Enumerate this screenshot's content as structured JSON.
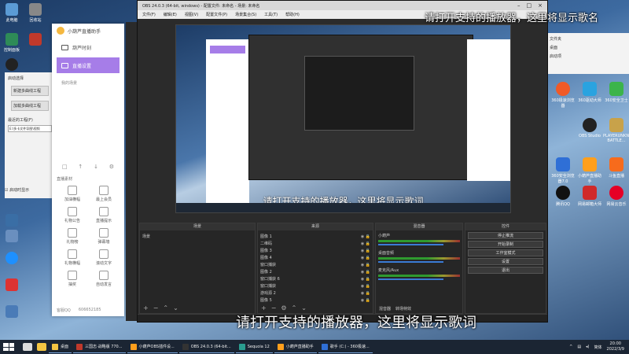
{
  "subtitles": {
    "top": "请打开支持的播放器，这里将显示歌名",
    "preview": "请打开支持的播放器，这里将显示歌词",
    "bottom": "请打开支持的播放器，这里将显示歌词"
  },
  "desktop_left": [
    "此电脑",
    "回收站",
    "控制面板",
    "",
    "",
    "",
    "",
    "",
    "",
    "",
    "",
    "",
    "",
    "",
    "",
    "",
    "",
    "",
    "",
    ""
  ],
  "left_panel": {
    "title": "启动选择",
    "button_new": "新建多曲线工程",
    "button_load": "加载多曲线工程",
    "recent_label": "最近的工程(F)",
    "recent_value": "E:\\多卡文件导图\\视频",
    "checkbox_label": "启动时显示"
  },
  "assistant": {
    "app_name": "小葫芦直播助手",
    "tabs": [
      "葫芦时刻",
      "直播设置"
    ],
    "sub_label": "我的场景",
    "section_label": "直播素材",
    "grid": [
      "加油横幅",
      "最上会员",
      "礼物公告",
      "直播提示",
      "礼物榜",
      "弹幕墙",
      "礼物横幅",
      "滚动文字",
      "抽奖",
      "自动发言"
    ],
    "footer": [
      "客服QQ",
      "606652185"
    ]
  },
  "obs": {
    "title": "OBS 24.0.3 (64-bit, windows) - 配置文件: 未命名 - 场景: 未命名",
    "menu": [
      "文件(F)",
      "编辑(E)",
      "视图(V)",
      "配置文件(P)",
      "场景集合(S)",
      "工具(T)",
      "帮助(H)"
    ],
    "docks": {
      "scenes": {
        "header": "场景",
        "items": [
          "场景"
        ]
      },
      "sources": {
        "header": "来源",
        "items": [
          "图像 1",
          "二维码",
          "图像 3",
          "图像 4",
          "窗口捕获",
          "图像 2",
          "窗口捕获 6",
          "窗口捕获",
          "游戏源 2",
          "图像 5"
        ]
      },
      "mixer": {
        "header": "混音器",
        "channels": [
          "小葫芦",
          "桌面音频",
          "麦克风/Aux"
        ],
        "tabs": [
          "混音器",
          "转场特效"
        ]
      },
      "controls": {
        "header": "控件",
        "buttons": [
          "停止推流",
          "开始录制",
          "工作室模式",
          "设置",
          "退出"
        ]
      }
    }
  },
  "right_window_items": [
    "文件夹",
    "桌面",
    "启动项"
  ],
  "desktop_right": [
    "360极速浏览器",
    "360驱动大师",
    "360安全卫士",
    "OBS Studio",
    "PLAYERUNKNOWN'S BATTLE...",
    "360安全浏览器7.0",
    "小葫芦直播助手",
    "斗鱼直播",
    "腾讯QQ",
    "网易邮箱大师",
    "网易云音乐"
  ],
  "taskbar": {
    "items": [
      "桌面",
      "三国志·战略版 770...",
      "小葫芦OBS插件设...",
      "OBS 24.0.3 (64-bit...",
      "Sequoia 12",
      "小葫芦直播助手",
      "歌手 (C:) - 360极速..."
    ],
    "ime": "简体",
    "time": "20:00",
    "date": "2022/3/9"
  },
  "colors": {
    "accent_purple": "#a67de8",
    "obs_bg": "#2b2b2b"
  }
}
